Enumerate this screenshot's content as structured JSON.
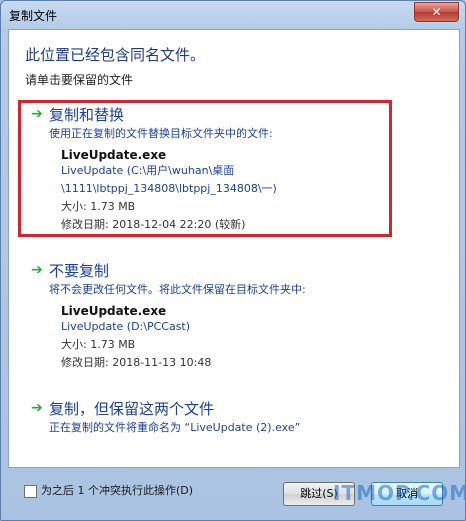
{
  "window": {
    "title": "复制文件",
    "close": "✕"
  },
  "header": "此位置已经包含同名文件。",
  "subheader": "请单击要保留的文件",
  "options": [
    {
      "title": "复制和替换",
      "desc": "使用正在复制的文件替换目标文件夹中的文件:",
      "filename": "LiveUpdate.exe",
      "path1": "LiveUpdate (C:\\用户\\wuhan\\桌面",
      "path2": "\\1111\\lbtppj_134808\\lbtppj_134808\\一)",
      "size": "大小: 1.73 MB",
      "date": "修改日期: 2018-12-04 22:20 (较新)"
    },
    {
      "title": "不要复制",
      "desc": "将不会更改任何文件。将此文件保留在目标文件夹中:",
      "filename": "LiveUpdate.exe",
      "path1": "LiveUpdate (D:\\PCCast)",
      "size": "大小: 1.73 MB",
      "date": "修改日期: 2018-11-13 10:48"
    },
    {
      "title": "复制，但保留这两个文件",
      "desc": "正在复制的文件将重命名为 “LiveUpdate (2).exe”"
    }
  ],
  "footer": {
    "checkbox_label": "为之后 1 个冲突执行此操作(D)",
    "skip_label": "跳过(S)",
    "cancel_label": "取消"
  },
  "watermark": "ITMOP.COM",
  "colors": {
    "accent": "#1a3fa6",
    "highlight": "#d9222c",
    "arrow": "#2aa93a"
  }
}
